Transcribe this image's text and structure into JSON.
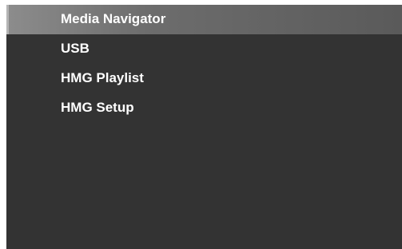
{
  "menu": {
    "selected_index": 0,
    "items": [
      {
        "label": "Media Navigator"
      },
      {
        "label": "USB"
      },
      {
        "label": "HMG Playlist"
      },
      {
        "label": "HMG Setup"
      }
    ]
  },
  "colors": {
    "screen_background": "#333333",
    "selection_highlight": "#6d6d6d",
    "text": "#ffffff"
  }
}
